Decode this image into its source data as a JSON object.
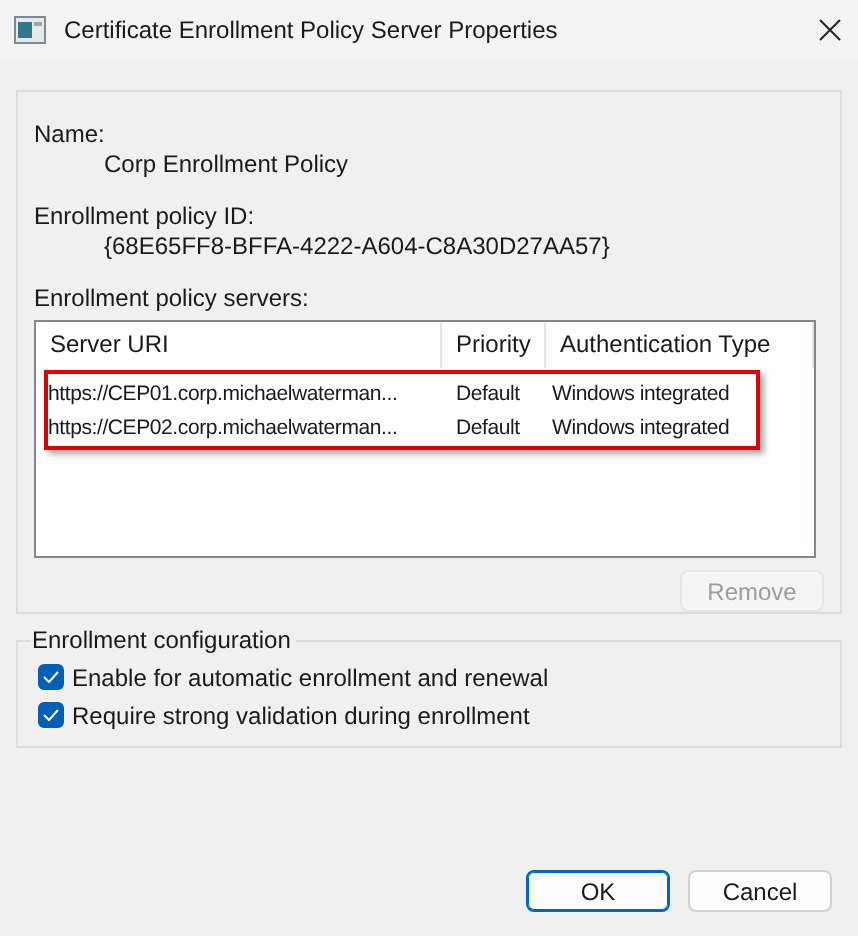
{
  "window": {
    "title": "Certificate Enrollment Policy Server Properties"
  },
  "policy": {
    "name_label": "Name:",
    "name_value": "Corp Enrollment Policy",
    "id_label": "Enrollment policy ID:",
    "id_value": "{68E65FF8-BFFA-4222-A604-C8A30D27AA57}",
    "servers_label": "Enrollment policy servers:"
  },
  "table": {
    "columns": [
      "Server URI",
      "Priority",
      "Authentication Type"
    ],
    "highlight_frame": true,
    "rows": [
      {
        "cells": [
          "https://CEP01.corp.michaelwaterman...",
          "Default",
          "Windows integrated"
        ]
      },
      {
        "cells": [
          "https://CEP02.corp.michaelwaterman...",
          "Default",
          "Windows integrated"
        ]
      }
    ]
  },
  "remove_button": {
    "label": "Remove",
    "disabled": true
  },
  "enrollment_configuration": {
    "title": "Enrollment configuration",
    "options": [
      {
        "label": "Enable for automatic enrollment and renewal",
        "checked": true
      },
      {
        "label": "Require strong validation during enrollment",
        "checked": true
      }
    ]
  },
  "buttons": [
    {
      "label": "OK",
      "default": true
    },
    {
      "label": "Cancel",
      "default": false
    }
  ]
}
